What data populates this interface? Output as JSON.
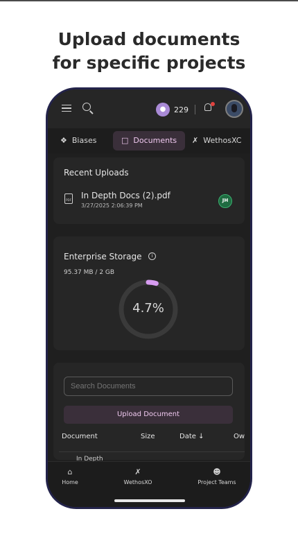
{
  "headline": {
    "line1": "Upload documents",
    "line2": "for specific projects"
  },
  "topbar": {
    "credits": "229",
    "menu_icon": "hamburger-menu-icon",
    "search_icon": "search-icon",
    "badge_icon": "owl-badge-icon",
    "bell_icon": "bell-icon"
  },
  "tabs": [
    {
      "label": "Biases",
      "icon": "brain-icon"
    },
    {
      "label": "Documents",
      "icon": "file-icon",
      "active": true
    },
    {
      "label": "WethosXC",
      "icon": "xo-icon"
    }
  ],
  "recent_uploads": {
    "title": "Recent Uploads",
    "file_name": "In Depth Docs (2).pdf",
    "file_date": "3/27/2025 2:06:39 PM",
    "file_icon_text": "PDF",
    "user_initials": "JH"
  },
  "storage": {
    "title": "Enterprise Storage",
    "used_text": "95.37 MB / 2 GB",
    "percent_label": "4.7%",
    "percent_value": 4.7
  },
  "documents": {
    "search_placeholder": "Search Documents",
    "upload_label": "Upload Document",
    "columns": [
      "Document",
      "Size",
      "Date ↓",
      "Ow"
    ],
    "rows": [
      {
        "document": "In Depth"
      }
    ]
  },
  "bottom_nav": [
    {
      "label": "Home",
      "icon": "home-icon"
    },
    {
      "label": "WethosXO",
      "icon": "xo-icon"
    },
    {
      "label": "Project Teams",
      "icon": "team-icon"
    }
  ],
  "colors": {
    "accent": "#f0c9f0",
    "accent_bg": "#3a2f3a",
    "ring_progress": "#d79cf0",
    "user_badge": "#1f6b41"
  }
}
